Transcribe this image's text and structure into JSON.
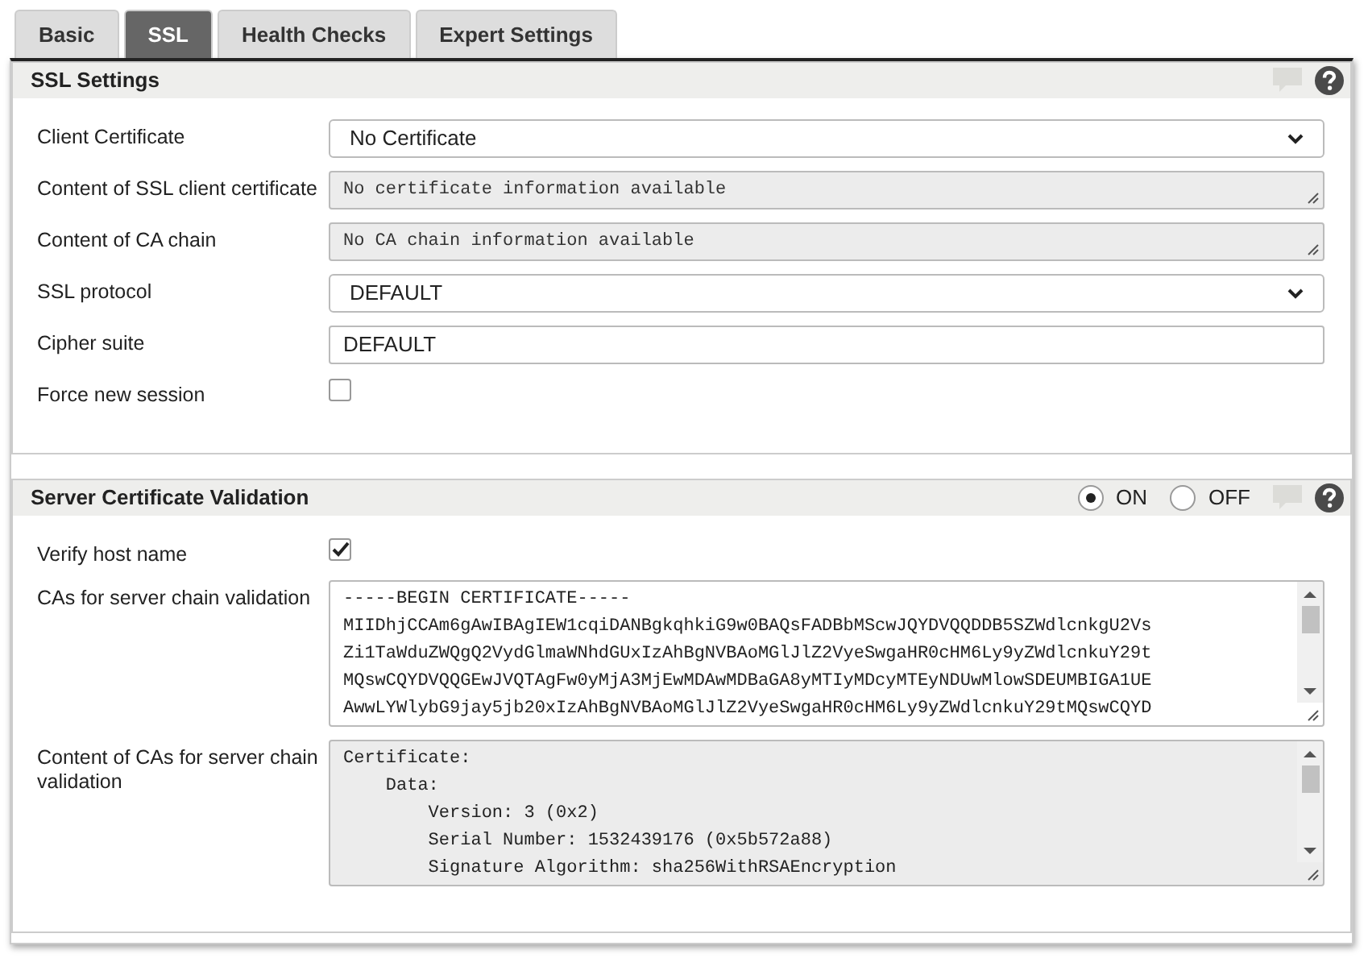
{
  "tabs": [
    {
      "label": "Basic",
      "selected": false
    },
    {
      "label": "SSL",
      "selected": true
    },
    {
      "label": "Health Checks",
      "selected": false
    },
    {
      "label": "Expert Settings",
      "selected": false
    }
  ],
  "sections": [
    {
      "title": "SSL Settings",
      "rows": [
        {
          "kind": "select",
          "label": "Client Certificate",
          "value": "No Certificate"
        },
        {
          "kind": "readonly",
          "label": "Content of SSL client certificate",
          "lines": [
            "No certificate information available"
          ]
        },
        {
          "kind": "readonly",
          "label": "Content of CA chain",
          "lines": [
            "No CA chain information available"
          ]
        },
        {
          "kind": "select",
          "label": "SSL protocol",
          "value": "DEFAULT"
        },
        {
          "kind": "text",
          "label": "Cipher suite",
          "value": "DEFAULT"
        },
        {
          "kind": "checkbox",
          "label": "Force new session",
          "checked": false
        }
      ]
    },
    {
      "title": "Server Certificate Validation",
      "toggle": [
        {
          "label": "ON",
          "selected": true
        },
        {
          "label": "OFF",
          "selected": false
        }
      ],
      "rows": [
        {
          "kind": "checkbox",
          "label": "Verify host name",
          "checked": true
        },
        {
          "kind": "editor",
          "label": "CAs for server chain validation",
          "lines": [
            "-----BEGIN CERTIFICATE-----",
            "MIIDhjCCAm6gAwIBAgIEW1cqiDANBgkqhkiG9w0BAQsFADBbMScwJQYDVQQDDB5SZWdlcnkgU2Vs",
            "Zi1TaWduZWQgQ2VydGlmaWNhdGUxIzAhBgNVBAoMGlJlZ2VyeSwgaHR0cHM6Ly9yZWdlcnkuY29t",
            "MQswCQYDVQQGEwJVQTAgFw0yMjA3MjEwMDAwMDBaGA8yMTIyMDcyMTEyNDUwMlowSDEUMBIGA1UE",
            "AwwLYWlybG9jay5jb20xIzAhBgNVBAoMGlJlZ2VyeSwgaHR0cHM6Ly9yZWdlcnkuY29tMQswCQYD"
          ]
        },
        {
          "kind": "viewer",
          "label": "Content of CAs for server chain validation",
          "lines": [
            "Certificate:",
            "    Data:",
            "        Version: 3 (0x2)",
            "        Serial Number: 1532439176 (0x5b572a88)",
            "        Signature Algorithm: sha256WithRSAEncryption"
          ]
        }
      ]
    }
  ]
}
